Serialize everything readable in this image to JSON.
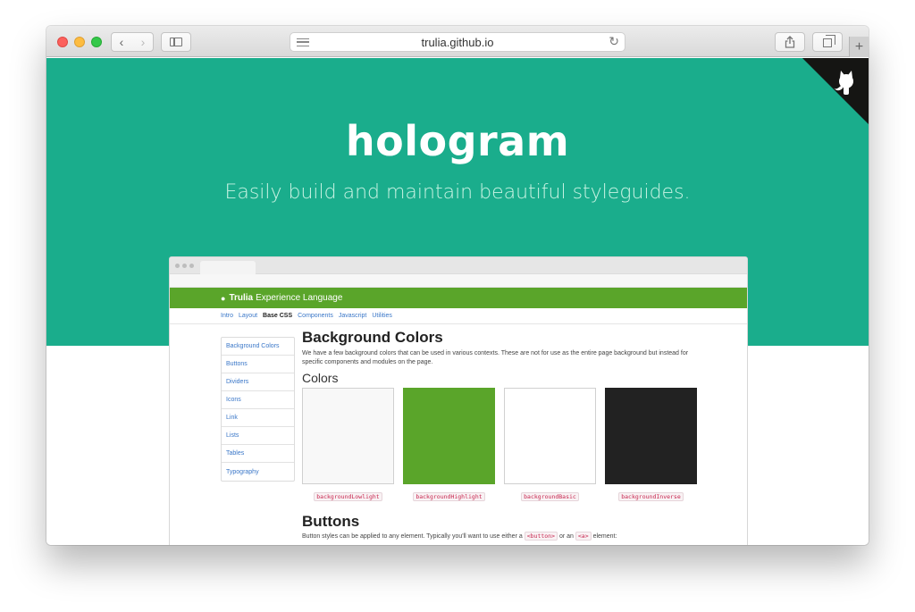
{
  "browser": {
    "url": "trulia.github.io",
    "back_glyph": "‹",
    "forward_glyph": "›",
    "new_tab_glyph": "+"
  },
  "hero": {
    "title": "hologram",
    "subtitle": "Easily build and maintain beautiful styleguides.",
    "background_color": "#1aad8c"
  },
  "preview": {
    "brand": {
      "name_bold": "Trulia",
      "name_rest": "Experience Language",
      "color": "#5aa52a"
    },
    "nav": [
      "Intro",
      "Layout",
      "Base CSS",
      "Components",
      "Javascript",
      "Utilities"
    ],
    "nav_active": "Base CSS",
    "sidebar": [
      "Background Colors",
      "Buttons",
      "Dividers",
      "Icons",
      "Link",
      "Lists",
      "Tables",
      "Typography"
    ],
    "heading": "Background Colors",
    "description": "We have a few background colors that can be used in various contexts. These are not for use as the entire page background but instead for specific components and modules on the page.",
    "subheading": "Colors",
    "swatches": [
      {
        "label": "backgroundLowlight",
        "color": "#f8f8f8"
      },
      {
        "label": "backgroundHighlight",
        "color": "#5aa52a"
      },
      {
        "label": "backgroundBasic",
        "color": "#ffffff"
      },
      {
        "label": "backgroundInverse",
        "color": "#222222"
      }
    ],
    "heading2": "Buttons",
    "buttons_text_1": "Button styles can be applied to any element. Typically you'll want to use either a",
    "buttons_code_1": "<button>",
    "buttons_text_2": "or an",
    "buttons_code_2": "<a>",
    "buttons_text_3": "element:"
  }
}
